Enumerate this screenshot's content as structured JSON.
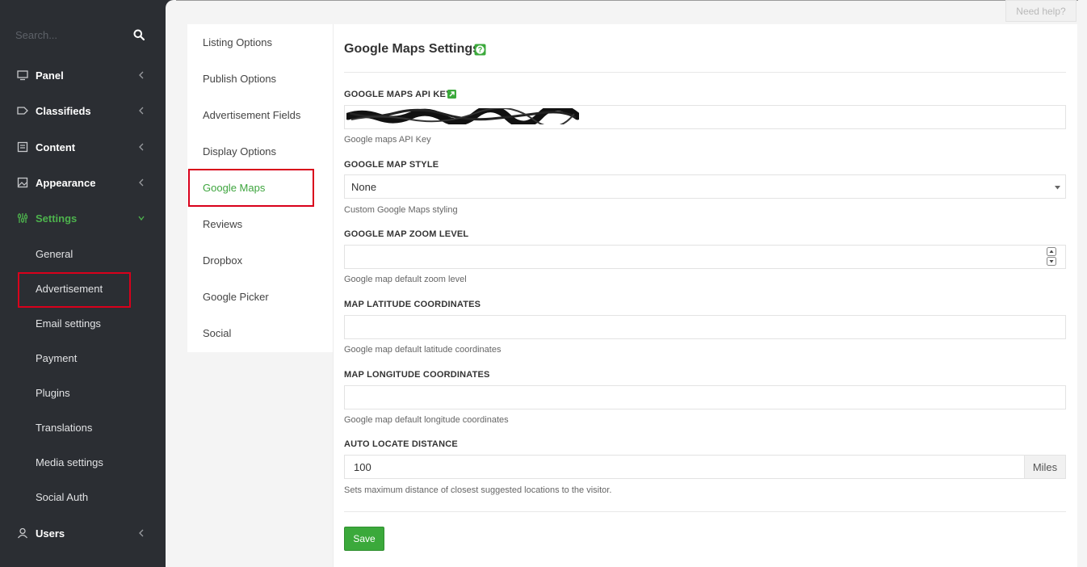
{
  "sidebar": {
    "search_placeholder": "Search...",
    "nav": [
      {
        "label": "Panel",
        "icon": "monitor-icon"
      },
      {
        "label": "Classifieds",
        "icon": "tag-icon"
      },
      {
        "label": "Content",
        "icon": "newspaper-icon"
      },
      {
        "label": "Appearance",
        "icon": "picture-icon"
      },
      {
        "label": "Settings",
        "icon": "sliders-icon",
        "active": true
      },
      {
        "label": "Users",
        "icon": "user-icon"
      }
    ],
    "settings_sub": [
      "General",
      "Advertisement",
      "Email settings",
      "Payment",
      "Plugins",
      "Translations",
      "Media settings",
      "Social Auth"
    ],
    "active_color": "#4db34d"
  },
  "header": {
    "help_label": "Need help?"
  },
  "subnav": {
    "items": [
      "Listing Options",
      "Publish Options",
      "Advertisement Fields",
      "Display Options",
      "Google Maps",
      "Reviews",
      "Dropbox",
      "Google Picker",
      "Social"
    ],
    "active": "Google Maps"
  },
  "panel": {
    "title": "Google Maps Settings",
    "fields": {
      "api_key": {
        "label": "GOOGLE MAPS API KEY",
        "value": "",
        "help": "Google maps API Key"
      },
      "map_style": {
        "label": "GOOGLE MAP STYLE",
        "value": "None",
        "help": "Custom Google Maps styling"
      },
      "zoom": {
        "label": "GOOGLE MAP ZOOM LEVEL",
        "value": "",
        "help": "Google map default zoom level"
      },
      "latitude": {
        "label": "MAP LATITUDE COORDINATES",
        "value": "",
        "help": "Google map default latitude coordinates"
      },
      "longitude": {
        "label": "MAP LONGITUDE COORDINATES",
        "value": "",
        "help": "Google map default longitude coordinates"
      },
      "distance": {
        "label": "AUTO LOCATE DISTANCE",
        "value": "100",
        "addon": "Miles",
        "help": "Sets maximum distance of closest suggested locations to the visitor."
      }
    },
    "save_label": "Save"
  },
  "colors": {
    "sidebar_bg": "#2b2e33",
    "accent": "#3ba93b",
    "highlight_box": "#d9001b"
  }
}
